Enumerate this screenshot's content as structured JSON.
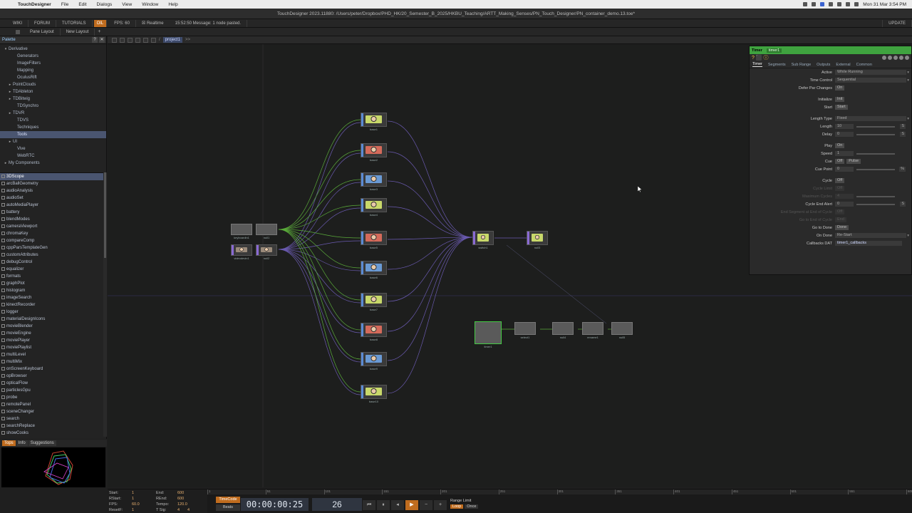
{
  "menubar": {
    "items": [
      "TouchDesigner",
      "File",
      "Edit",
      "Dialogs",
      "View",
      "Window",
      "Help"
    ],
    "clock": "Mon 31 Mar 3:54 PM"
  },
  "window_title": "TouchDesigner 2023.11880: /Users/peter/Dropbox/PHD_HK/20_Semester_B_2025/HKBU_Teaching/ARTT_Making_Senses/PN_Touch_Designer/PN_container_demo.13.toe*",
  "toolbar": {
    "wiki": "WIKI",
    "forum": "FORUM",
    "tutorials": "TUTORIALS",
    "oil": "OIL",
    "fps": "FPS:  60",
    "realtime": "Realtime",
    "message": "15:52:50 Message: 1 node pasted.",
    "update": "UPDATE",
    "pane_layout": "Pane Layout",
    "new_layout": "New Layout"
  },
  "path": {
    "crumb": "project1",
    "arrows": ">>"
  },
  "palette": {
    "title": "Palette",
    "tree": [
      {
        "label": "Derivative",
        "arrow": "▾",
        "indent": 0
      },
      {
        "label": "Generators",
        "arrow": "",
        "indent": 2
      },
      {
        "label": "ImageFilters",
        "arrow": "",
        "indent": 2
      },
      {
        "label": "Mapping",
        "arrow": "",
        "indent": 2
      },
      {
        "label": "OculusRift",
        "arrow": "",
        "indent": 2
      },
      {
        "label": "PointClouds",
        "arrow": "▸",
        "indent": 1
      },
      {
        "label": "TDAbleton",
        "arrow": "▸",
        "indent": 1
      },
      {
        "label": "TDBitwig",
        "arrow": "▸",
        "indent": 1
      },
      {
        "label": "TDSynchro",
        "arrow": "",
        "indent": 2
      },
      {
        "label": "TDVR",
        "arrow": "▸",
        "indent": 1
      },
      {
        "label": "TDVS",
        "arrow": "",
        "indent": 2
      },
      {
        "label": "Techniques",
        "arrow": "",
        "indent": 2
      },
      {
        "label": "Tools",
        "arrow": "",
        "indent": 2,
        "selected": true
      },
      {
        "label": "UI",
        "arrow": "▸",
        "indent": 1
      },
      {
        "label": "Vive",
        "arrow": "",
        "indent": 2
      },
      {
        "label": "WebRTC",
        "arrow": "",
        "indent": 2
      },
      {
        "label": "My Components",
        "arrow": "▸",
        "indent": 0
      }
    ],
    "components": [
      "3DScope",
      "arcBallGeometry",
      "audioAnalysis",
      "audioSet",
      "autoMediaPlayer",
      "battery",
      "blendModes",
      "cameraViewport",
      "chromaKey",
      "compareComp",
      "cppParsTemplateGen",
      "customAttributes",
      "debugControl",
      "equalizer",
      "formats",
      "graphPlot",
      "histogram",
      "imageSearch",
      "kinectRecorder",
      "logger",
      "materialDesignIcons",
      "movieBlender",
      "movieEngine",
      "moviePlayer",
      "moviePlaylist",
      "multiLevel",
      "multiMix",
      "onScreenKeyboard",
      "opBrowser",
      "opticalFlow",
      "particlesGpu",
      "probe",
      "remotePanel",
      "sceneChanger",
      "search",
      "searchReplace",
      "showCooks"
    ],
    "bottom_tabs": [
      "Tops",
      "Info",
      "Suggestions"
    ]
  },
  "network": {
    "left_nodes": [
      {
        "label": "keyboardin1",
        "kind": "chop"
      },
      {
        "label": "null1",
        "kind": "chop"
      },
      {
        "label": "videodevin1",
        "kind": "top"
      },
      {
        "label": "null2",
        "kind": "top"
      }
    ],
    "base_nodes": [
      {
        "label": "base1",
        "tint": "#c8d86a"
      },
      {
        "label": "base2",
        "tint": "#d46a5a"
      },
      {
        "label": "base3",
        "tint": "#6a9ad4"
      },
      {
        "label": "base4",
        "tint": "#c8d86a"
      },
      {
        "label": "base5",
        "tint": "#d46a5a"
      },
      {
        "label": "base6",
        "tint": "#6a9ad4"
      },
      {
        "label": "base7",
        "tint": "#c8d86a"
      },
      {
        "label": "base8",
        "tint": "#d46a5a"
      },
      {
        "label": "base9",
        "tint": "#6a9ad4"
      },
      {
        "label": "base10",
        "tint": "#c8d86a"
      }
    ],
    "switch_label": "switch1",
    "out_label": "null3",
    "chop_chain": [
      "timer1",
      "select1",
      "null4",
      "rename1",
      "null5"
    ]
  },
  "params": {
    "type": "Timer",
    "name": "timer1",
    "tabs": [
      "Timer",
      "Segments",
      "Sub Range",
      "Outputs",
      "External",
      "Common"
    ],
    "rows": [
      {
        "label": "Active",
        "value": "While Running",
        "kind": "menu"
      },
      {
        "label": "Time Control",
        "value": "Sequential",
        "kind": "menu"
      },
      {
        "label": "Defer Par Changes",
        "value": "On",
        "kind": "toggle"
      },
      {
        "gap": true
      },
      {
        "label": "Initialize",
        "value": "Init",
        "kind": "button"
      },
      {
        "label": "Start",
        "value": "Start",
        "kind": "button"
      },
      {
        "gap": true
      },
      {
        "label": "Length Type",
        "value": "Fixed",
        "kind": "menu"
      },
      {
        "label": "Length",
        "value": "10",
        "kind": "num",
        "unit": "S"
      },
      {
        "label": "Delay",
        "value": "0",
        "kind": "num",
        "unit": "S"
      },
      {
        "gap": true
      },
      {
        "label": "Play",
        "value": "On",
        "kind": "toggle"
      },
      {
        "label": "Speed",
        "value": "1",
        "kind": "num"
      },
      {
        "label": "Cue",
        "value": "Off",
        "kind": "toggle2",
        "value2": "Pulse"
      },
      {
        "label": "Cue Point",
        "value": "0",
        "kind": "num",
        "unit": "%"
      },
      {
        "gap": true
      },
      {
        "label": "Cycle",
        "value": "Off",
        "kind": "toggle"
      },
      {
        "label": "Cycle Limit",
        "value": "Off",
        "kind": "toggle",
        "dim": true
      },
      {
        "label": "Maximum Cycles",
        "value": "4",
        "kind": "num",
        "dim": true
      },
      {
        "label": "Cycle End Alert",
        "value": "0",
        "kind": "num",
        "unit": "S"
      },
      {
        "label": "End Segment at End of Cycle",
        "value": "Off",
        "kind": "toggle",
        "dim": true
      },
      {
        "label": "Go to End of Cycle",
        "value": "End",
        "kind": "button",
        "dim": true
      },
      {
        "label": "Go to Done",
        "value": "Done",
        "kind": "button"
      },
      {
        "label": "On Done",
        "value": "Re-Start",
        "kind": "menu"
      },
      {
        "label": "Callbacks DAT",
        "value": "timer1_callbacks",
        "kind": "text"
      }
    ]
  },
  "timeline": {
    "start": "1",
    "end": "600",
    "rstart": "1",
    "rend": "600",
    "fps": "60.0",
    "tempo": "120.0",
    "resetf": "1",
    "tsig_a": "4",
    "tsig_b": "4",
    "labels": {
      "start": "Start:",
      "end": "End:",
      "rstart": "RStart:",
      "rend": "REnd:",
      "fps": "FPS:",
      "tempo": "Tempo:",
      "resetf": "ResetF:",
      "tsig": "T Sig:"
    },
    "ticks": [
      "1",
      "51",
      "101",
      "151",
      "201",
      "251",
      "301",
      "351",
      "401",
      "451",
      "501",
      "551",
      "600"
    ],
    "timecode_label": "TimeCode",
    "beats_label": "Beats",
    "timecode": "00:00:00:25",
    "frame": "26",
    "range_limit": "Range Limit",
    "loop": "Loop",
    "once": "Once"
  }
}
